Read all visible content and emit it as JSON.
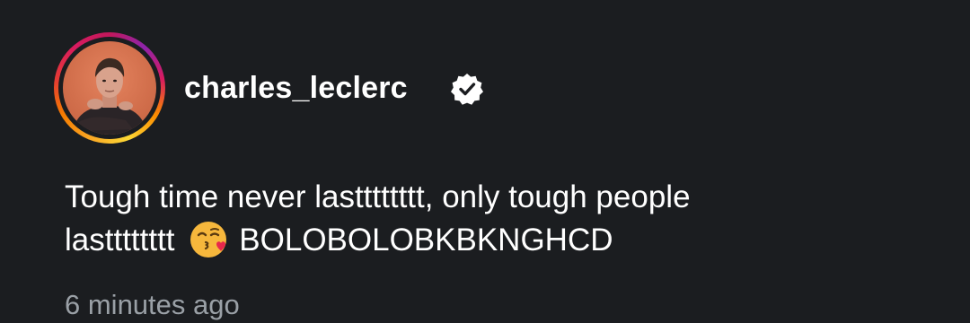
{
  "post": {
    "username": "charles_leclerc",
    "verified_icon": "verified-badge-icon",
    "caption_line1": "Tough time never lastttttttt, only tough people",
    "caption_line2_start": "lastttttttt",
    "caption_emoji_icon": "face-blowing-kiss-emoji",
    "caption_line2_end": "BOLOBOLOBKBKNGHCD",
    "timestamp": "6 minutes ago"
  },
  "colors": {
    "background": "#1b1d20",
    "text": "#ffffff",
    "muted_text": "#9aa0a6",
    "story_ring_start": "#f9a825",
    "story_ring_end": "#d81b60"
  }
}
